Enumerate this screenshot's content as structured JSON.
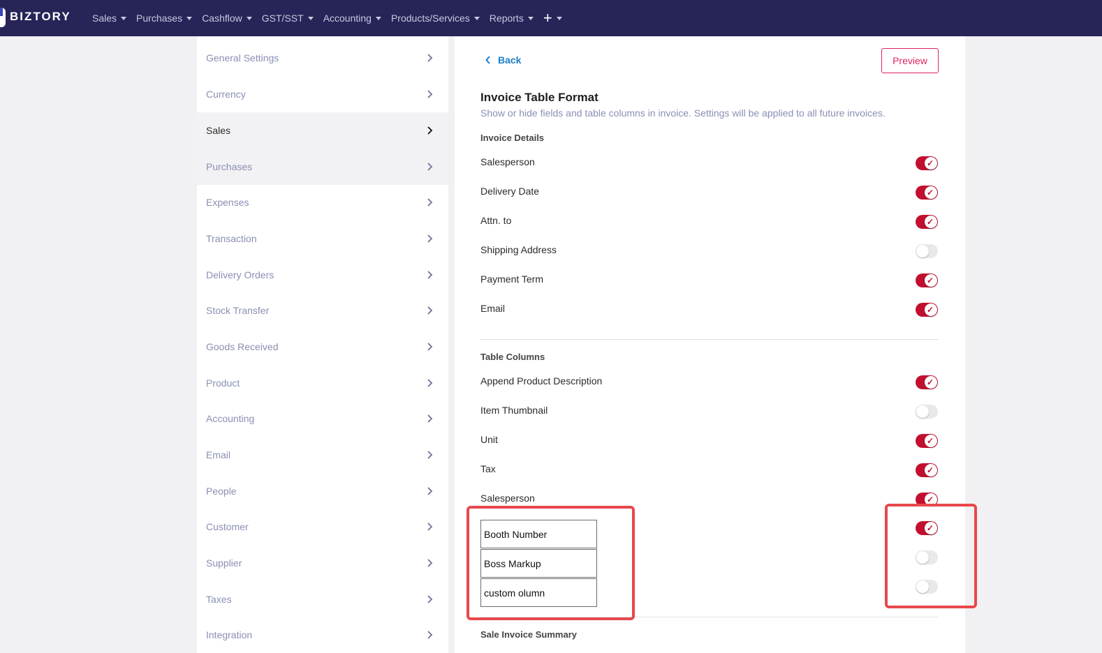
{
  "app": {
    "logo": "BIZTORY"
  },
  "nav": {
    "items": [
      "Sales",
      "Purchases",
      "Cashflow",
      "GST/SST",
      "Accounting",
      "Products/Services",
      "Reports"
    ],
    "plus": "+"
  },
  "sidebar": {
    "items": [
      "General Settings",
      "Currency",
      "Sales",
      "Purchases",
      "Expenses",
      "Transaction",
      "Delivery Orders",
      "Stock Transfer",
      "Goods Received",
      "Product",
      "Accounting",
      "Email",
      "People",
      "Customer",
      "Supplier",
      "Taxes",
      "Integration"
    ],
    "active": "Sales"
  },
  "main": {
    "back_label": "Back",
    "preview_label": "Preview",
    "title": "Invoice Table Format",
    "subtitle": "Show or hide fields and table columns in invoice. Settings will be applied to all future invoices.",
    "invoice_details": {
      "title": "Invoice Details",
      "rows": [
        {
          "label": "Salesperson",
          "on": true
        },
        {
          "label": "Delivery Date",
          "on": true
        },
        {
          "label": "Attn. to",
          "on": true
        },
        {
          "label": "Shipping Address",
          "on": false
        },
        {
          "label": "Payment Term",
          "on": true
        },
        {
          "label": "Email",
          "on": true
        }
      ]
    },
    "table_columns": {
      "title": "Table Columns",
      "rows": [
        {
          "label": "Append Product Description",
          "on": true
        },
        {
          "label": "Item Thumbnail",
          "on": false
        },
        {
          "label": "Unit",
          "on": true
        },
        {
          "label": "Tax",
          "on": true
        },
        {
          "label": "Salesperson",
          "on": true
        }
      ],
      "custom_columns": [
        {
          "value": "Booth Number",
          "on": true
        },
        {
          "value": "Boss Markup",
          "on": false
        },
        {
          "value": "custom olumn",
          "on": false
        }
      ]
    },
    "summary_title": "Sale Invoice Summary"
  },
  "colors": {
    "nav_bg": "#272458",
    "toggle_on": "#c20f2f",
    "accent": "#e0245e",
    "highlight": "#e8484c"
  }
}
